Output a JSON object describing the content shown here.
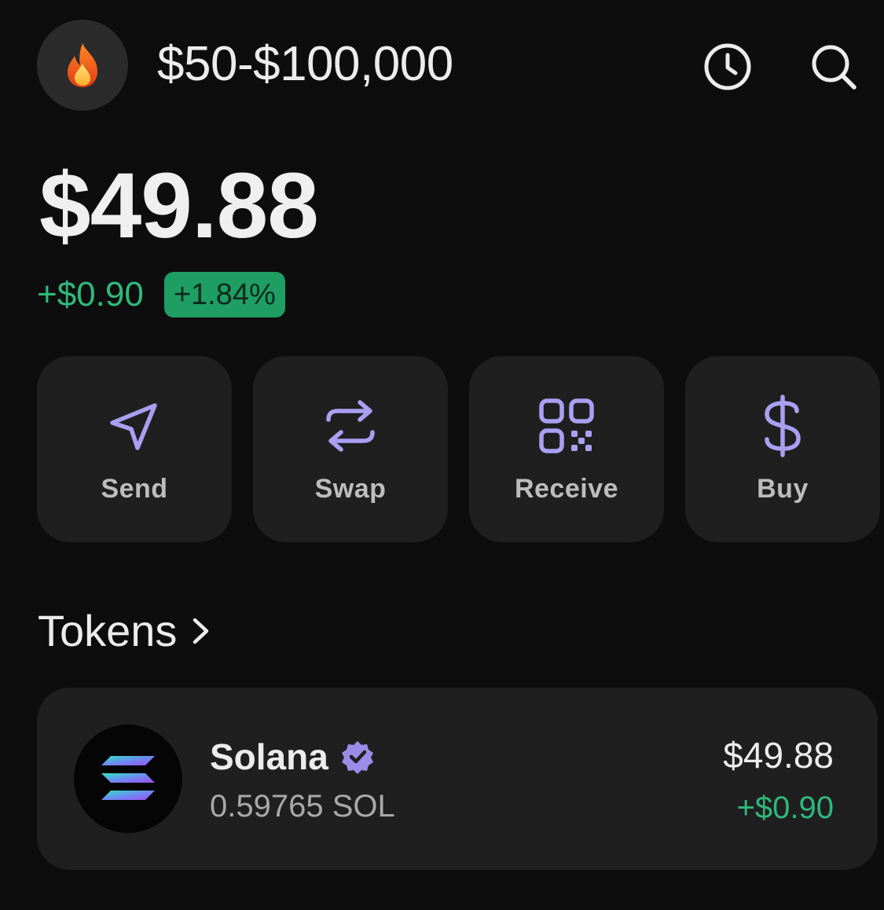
{
  "header": {
    "account_name": "$50-$100,000",
    "avatar_icon": "fire-icon",
    "history_icon": "clock-icon",
    "search_icon": "search-icon"
  },
  "balance": {
    "total": "$49.88",
    "change_amount": "+$0.90",
    "change_percent": "+1.84%"
  },
  "actions": [
    {
      "label": "Send",
      "icon": "send-icon"
    },
    {
      "label": "Swap",
      "icon": "swap-icon"
    },
    {
      "label": "Receive",
      "icon": "qr-code-icon"
    },
    {
      "label": "Buy",
      "icon": "dollar-icon"
    }
  ],
  "tokens": {
    "title": "Tokens",
    "items": [
      {
        "name": "Solana",
        "amount": "0.59765 SOL",
        "value": "$49.88",
        "change": "+$0.90",
        "verified": true
      }
    ]
  },
  "colors": {
    "background": "#0d0d0d",
    "card": "#1f1f20",
    "accent_purple": "#ab9ff2",
    "positive_green": "#2fb97a",
    "badge_green": "#1f9e63"
  }
}
